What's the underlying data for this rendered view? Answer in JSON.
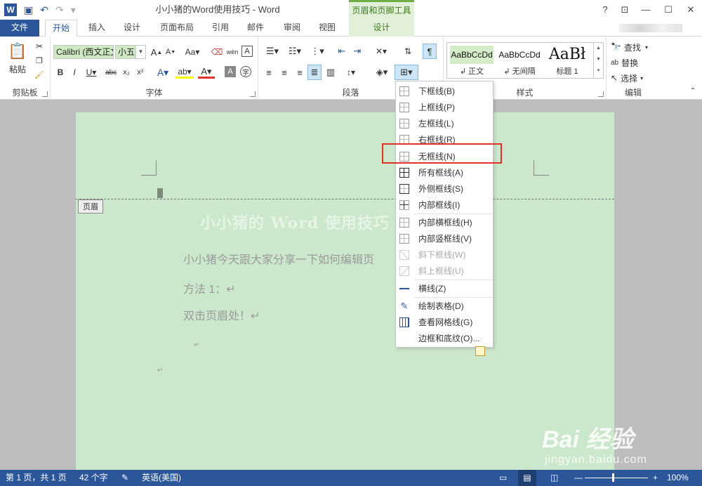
{
  "window": {
    "title": "小小猪的Word使用技巧 - Word",
    "context_tab_group": "页眉和页脚工具",
    "controls": [
      "?",
      "⊡",
      "—",
      "☐",
      "✕"
    ]
  },
  "qat": {
    "undo": "↶",
    "redo": "↷",
    "more": "▾"
  },
  "tabs": {
    "file": "文件",
    "home": "开始",
    "insert": "插入",
    "design": "设计",
    "layout": "页面布局",
    "references": "引用",
    "mailings": "邮件",
    "review": "审阅",
    "view": "视图",
    "hf_design": "设计"
  },
  "ribbon": {
    "clipboard": {
      "paste": "粘贴",
      "label": "剪贴板"
    },
    "font": {
      "name": "Calibri (西文正文)",
      "size": "小五",
      "label": "字体"
    },
    "paragraph": {
      "label": "段落"
    },
    "styles": {
      "label": "样式",
      "items": [
        {
          "preview": "AaBbCcDd",
          "name": "↲ 正文"
        },
        {
          "preview": "AaBbCcDd",
          "name": "↲ 无间隔"
        },
        {
          "preview": "AaBł",
          "name": "标题 1"
        }
      ]
    },
    "editing": {
      "find": "查找",
      "replace": "替换",
      "select": "选择",
      "label": "编辑"
    }
  },
  "document": {
    "header_tag": "页眉",
    "title": "小小猪的 Word 使用技巧",
    "lines": [
      "小小猪今天跟大家分享一下如何编辑页",
      "方法 1：↵",
      "双击页眉处！↵"
    ],
    "para_mark": "↵"
  },
  "borders_menu": {
    "items": [
      {
        "label": "下框线(B)",
        "enabled": true
      },
      {
        "label": "上框线(P)",
        "enabled": true
      },
      {
        "label": "左框线(L)",
        "enabled": true
      },
      {
        "label": "右框线(R)",
        "enabled": true
      },
      {
        "label": "无框线(N)",
        "enabled": true
      },
      {
        "label": "所有框线(A)",
        "enabled": true
      },
      {
        "label": "外侧框线(S)",
        "enabled": true
      },
      {
        "label": "内部框线(I)",
        "enabled": true
      },
      {
        "label": "内部横框线(H)",
        "enabled": true
      },
      {
        "label": "内部竖框线(V)",
        "enabled": true
      },
      {
        "label": "斜下框线(W)",
        "enabled": false
      },
      {
        "label": "斜上框线(U)",
        "enabled": false
      },
      {
        "label": "横线(Z)",
        "enabled": true
      },
      {
        "label": "绘制表格(D)",
        "enabled": true
      },
      {
        "label": "查看网格线(G)",
        "enabled": true
      },
      {
        "label": "边框和底纹(O)...",
        "enabled": true
      }
    ]
  },
  "statusbar": {
    "page": "第 1 页，共 1 页",
    "words": "42 个字",
    "language": "英语(美国)",
    "zoom": "100%"
  },
  "watermark": {
    "main": "Bai 经验",
    "sub": "jingyan.baidu.com"
  },
  "colors": {
    "word_blue": "#2b579a",
    "context_green": "#70ad47",
    "page_bg": "#cce8cc",
    "highlight_red": "#e0322b"
  }
}
